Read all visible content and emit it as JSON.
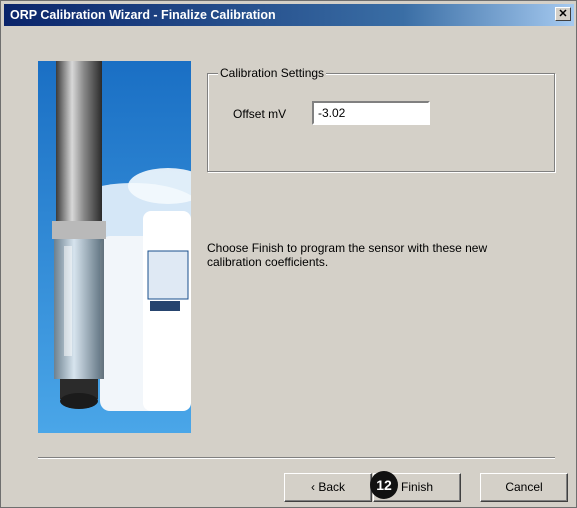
{
  "window": {
    "title": "ORP Calibration Wizard - Finalize Calibration",
    "close_glyph": "✕"
  },
  "group": {
    "legend": "Calibration Settings",
    "offset_label": "Offset mV",
    "offset_value": "-3.02"
  },
  "instruction": "Choose Finish to program the sensor with these new calibration coefficients.",
  "buttons": {
    "back": "‹ Back",
    "finish": "Finish",
    "cancel": "Cancel"
  },
  "callout": "12",
  "colors": {
    "title_bar": "#0a246a",
    "dialog_bg": "#d4d0c8",
    "image_bg": "#2f8ed6"
  }
}
